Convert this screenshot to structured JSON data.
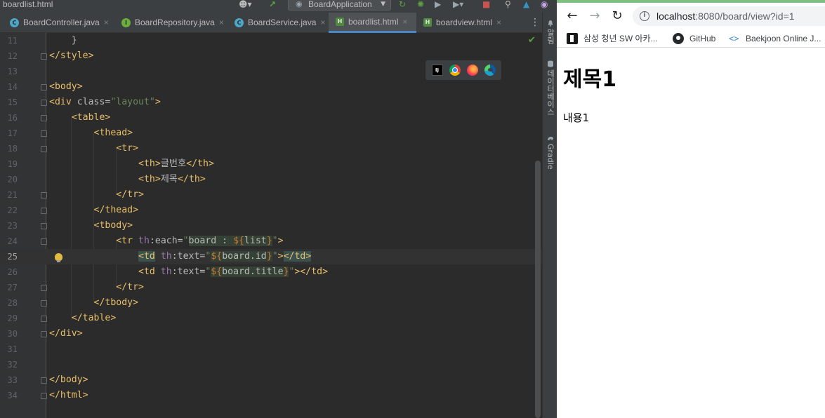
{
  "ide": {
    "window_title": "boardlist.html",
    "run_config": "BoardApplication",
    "tabs": [
      {
        "label": "BoardController.java",
        "icon": "class-icon"
      },
      {
        "label": "BoardRepository.java",
        "icon": "interface-icon"
      },
      {
        "label": "BoardService.java",
        "icon": "class-icon"
      },
      {
        "label": "boardlist.html",
        "icon": "html-file-icon",
        "active": true
      },
      {
        "label": "boardview.html",
        "icon": "html-file-icon"
      }
    ],
    "line_numbers": [
      "11",
      "12",
      "13",
      "14",
      "15",
      "16",
      "17",
      "18",
      "19",
      "20",
      "21",
      "22",
      "23",
      "24",
      "25",
      "26",
      "27",
      "28",
      "29",
      "30",
      "31",
      "32",
      "33",
      "34"
    ],
    "current_line": "25",
    "code": {
      "l11": "    }",
      "l12": "</style>",
      "l14": "<body>",
      "l15_open": "<div ",
      "l15_attr": "class=",
      "l15_val": "\"layout\"",
      "l15_close": ">",
      "l16": "    <table>",
      "l17": "        <thead>",
      "l18": "            <tr>",
      "l19_open": "                <th>",
      "l19_text": "글번호",
      "l19_close": "</th>",
      "l20_open": "                <th>",
      "l20_text": "제목",
      "l20_close": "</th>",
      "l21": "            </tr>",
      "l22": "        </thead>",
      "l23": "        <tbody>",
      "l24_open": "            <tr ",
      "l24_ns": "th",
      "l24_attr": ":each=",
      "l24_q1": "\"",
      "l24_expr1": "board : ",
      "l24_b1": "${",
      "l24_expr2": "list",
      "l24_b2": "}",
      "l24_q2": "\"",
      "l24_close": ">",
      "l25_indent": "                ",
      "l25_open": "<td",
      "l25_sp": " ",
      "l25_ns": "th",
      "l25_attr": ":text=",
      "l25_q1": "\"",
      "l25_b1": "${",
      "l25_expr": "board.id",
      "l25_b2": "}",
      "l25_q2": "\"",
      "l25_gt": ">",
      "l25_end": "</td>",
      "l26_open": "                <td ",
      "l26_ns": "th",
      "l26_attr": ":text=",
      "l26_q1": "\"",
      "l26_b1": "${",
      "l26_expr": "board.title",
      "l26_b2": "}",
      "l26_q2": "\"",
      "l26_close": "></td>",
      "l27": "            </tr>",
      "l28": "        </tbody>",
      "l29": "    </table>",
      "l30": "</div>",
      "l33": "</body>",
      "l34": "</html>"
    },
    "right_panel": [
      {
        "label": "알림",
        "icon": "bell-icon"
      },
      {
        "label": "데이터베이스",
        "icon": "database-icon"
      },
      {
        "label": "Gradle",
        "icon": "gradle-icon"
      }
    ],
    "colors": {
      "tag": "#e8bf6a",
      "string": "#6a8759",
      "namespace": "#9876aa",
      "accent": "#4a88c7"
    }
  },
  "browser": {
    "url_host": "localhost",
    "url_path": ":8080/board/view?id=1",
    "bookmarks": [
      {
        "label": "삼성 청년 SW 아카...",
        "icon": "ssafy-icon"
      },
      {
        "label": "GitHub",
        "icon": "github-icon"
      },
      {
        "label": "Baekjoon Online J...",
        "icon": "baekjoon-icon"
      }
    ],
    "page": {
      "heading": "제목1",
      "content": "내용1"
    }
  }
}
